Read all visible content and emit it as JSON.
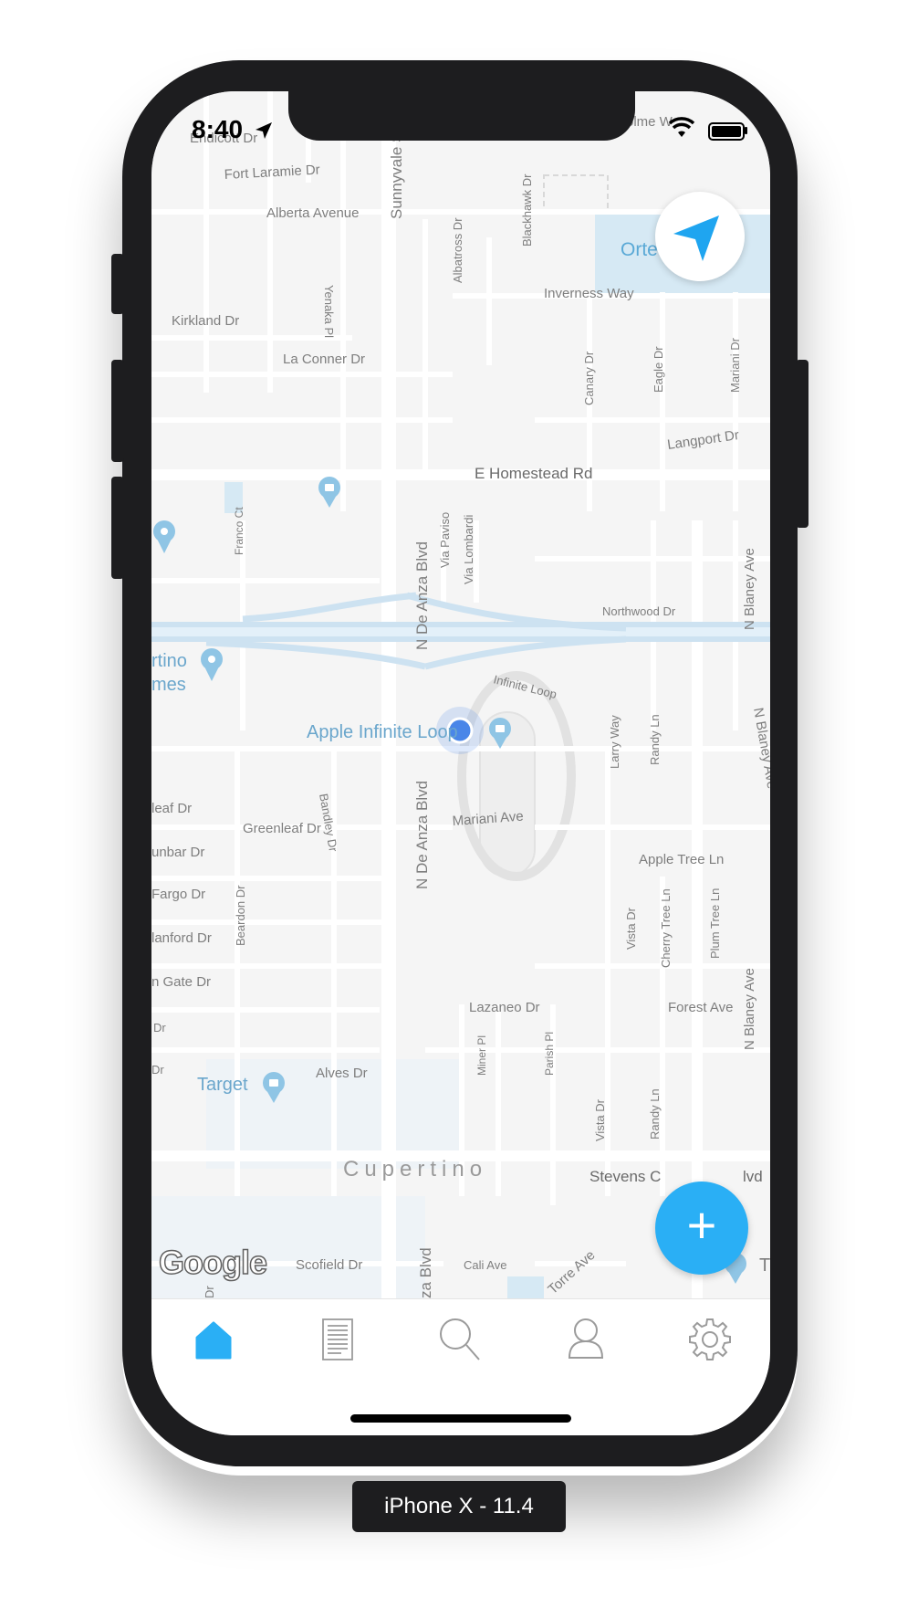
{
  "status_bar": {
    "time": "8:40"
  },
  "map": {
    "labels": {
      "endicott": "Endicott Dr",
      "fort_laramie": "Fort Laramie Dr",
      "alberta": "Alberta Avenue",
      "yenaka": "Yenaka Pl",
      "sunnyvale": "Sunnyvale Sa",
      "albatross": "Albatross Dr",
      "blackhawk": "Blackhawk Dr",
      "inverness": "Inverness Way",
      "ortega": "Orte",
      "kirkland": "Kirkland Dr",
      "la_conner": "La Conner Dr",
      "canary": "Canary Dr",
      "eagle": "Eagle Dr",
      "mariani_top": "Mariani Dr",
      "langport": "Langport Dr",
      "homestead": "E Homestead Rd",
      "franco": "Franco Ct",
      "via_paviso": "Via Paviso",
      "via_lombardi": "Via Lombardi",
      "de_anza_1": "N De Anza Blvd",
      "blaney_1": "N Blaney Ave",
      "northwood": "Northwood Dr",
      "cupertino_homes_1": "rtino",
      "cupertino_homes_2": "mes",
      "infinite_loop": "Infinite Loop",
      "apple_infinite_loop": "Apple Infinite Loop",
      "larry": "Larry Way",
      "randy_1": "Randy Ln",
      "blaney_2": "N Blaney Ave",
      "leaf": "leaf Dr",
      "greenleaf": "Greenleaf Dr",
      "bandley": "Bandley Dr",
      "mariani_ave": "Mariani Ave",
      "de_anza_2": "N De Anza Blvd",
      "dunbar": "unbar Dr",
      "apple_tree": "Apple Tree Ln",
      "fargo": "Fargo Dr",
      "beardon": "Beardon Dr",
      "vista_1": "Vista Dr",
      "cherry_tree": "Cherry Tree Ln",
      "plum_tree": "Plum Tree Ln",
      "blaney_3": "N Blaney Ave",
      "stanford": "lanford Dr",
      "gate": "n Gate Dr",
      "lazaneo": "Lazaneo Dr",
      "forest": "Forest Ave",
      "dr_1": "Dr",
      "miner": "Miner Pl",
      "parish": "Parish Pl",
      "dr_2": "Dr",
      "target": "Target",
      "alves": "Alves Dr",
      "vista_2": "Vista Dr",
      "randy_2": "Randy Ln",
      "cupertino": "Cupertino",
      "stevens_creek": "Stevens C",
      "stevens_creek_2": "lvd",
      "scofield": "Scofield Dr",
      "cali": "Cali Ave",
      "torre": "Torre Ave",
      "de_anza_3": "za Blvd",
      "dr_3": "Dr",
      "t_edge": "T",
      "holme": "olme W"
    }
  },
  "buttons": {
    "fab_label": "+"
  },
  "google_logo": "Google",
  "tabbar": {
    "active_color": "#2aaff5",
    "inactive_color": "#9b9b9b"
  },
  "device_label": "iPhone X - 11.4"
}
